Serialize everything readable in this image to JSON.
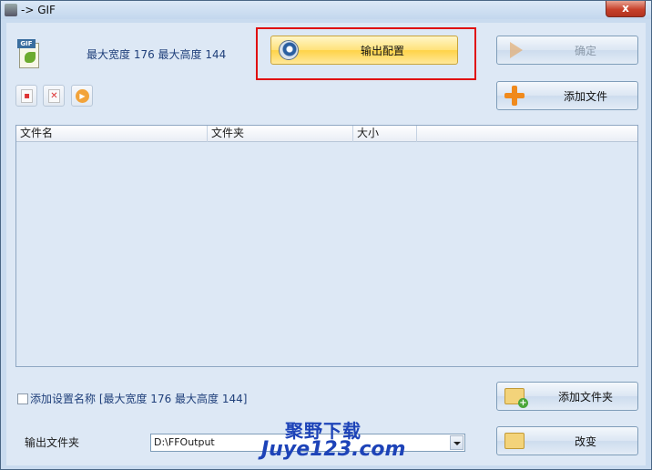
{
  "window": {
    "title": "-> GIF",
    "close_label": "x"
  },
  "header": {
    "max_size_text": "最大宽度 176 最大高度 144"
  },
  "buttons": {
    "output_config": "输出配置",
    "confirm": "确定",
    "add_file": "添加文件",
    "add_folder": "添加文件夹",
    "change": "改变"
  },
  "toolbar": {
    "icons": [
      "remove-file-icon",
      "delete-icon",
      "play-icon"
    ]
  },
  "list": {
    "columns": [
      "文件名",
      "文件夹",
      "大小"
    ],
    "rows": []
  },
  "option": {
    "add_setting_name_label": "添加设置名称 [最大宽度 176 最大高度 144]",
    "checked": false
  },
  "output": {
    "label": "输出文件夹",
    "path": "D:\\FFOutput"
  },
  "watermark": {
    "line1": "聚野下载",
    "line2": "Juye123.com"
  },
  "colors": {
    "highlight_box": "#e01010",
    "primary_button": "#ffd347",
    "watermark": "#1d43b8"
  }
}
